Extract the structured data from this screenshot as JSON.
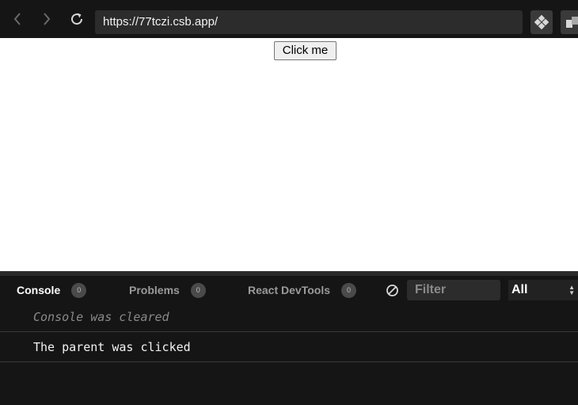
{
  "browser": {
    "url": "https://77tczi.csb.app/"
  },
  "page": {
    "button_label": "Click me"
  },
  "console_panel": {
    "tabs": [
      {
        "label": "Console",
        "count": "0"
      },
      {
        "label": "Problems",
        "count": "0"
      },
      {
        "label": "React DevTools",
        "count": "0"
      }
    ],
    "filter_placeholder": "Filter",
    "level": "All",
    "logs": [
      "Console was cleared",
      "The parent was clicked"
    ]
  },
  "colors": {
    "toolbar_bg": "#151515",
    "urlbar_bg": "#2c2c2c",
    "console_bg": "#151515",
    "page_bg": "#ffffff"
  }
}
